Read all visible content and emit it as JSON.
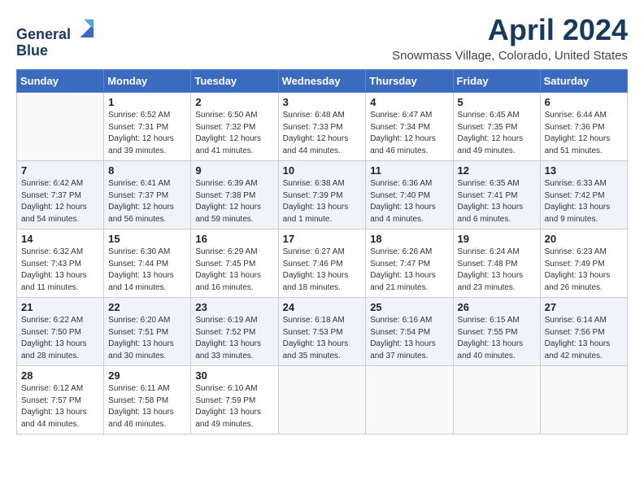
{
  "header": {
    "logo_line1": "General",
    "logo_line2": "Blue",
    "title": "April 2024",
    "subtitle": "Snowmass Village, Colorado, United States"
  },
  "calendar": {
    "days_of_week": [
      "Sunday",
      "Monday",
      "Tuesday",
      "Wednesday",
      "Thursday",
      "Friday",
      "Saturday"
    ],
    "weeks": [
      [
        {
          "day": "",
          "info": ""
        },
        {
          "day": "1",
          "info": "Sunrise: 6:52 AM\nSunset: 7:31 PM\nDaylight: 12 hours\nand 39 minutes."
        },
        {
          "day": "2",
          "info": "Sunrise: 6:50 AM\nSunset: 7:32 PM\nDaylight: 12 hours\nand 41 minutes."
        },
        {
          "day": "3",
          "info": "Sunrise: 6:48 AM\nSunset: 7:33 PM\nDaylight: 12 hours\nand 44 minutes."
        },
        {
          "day": "4",
          "info": "Sunrise: 6:47 AM\nSunset: 7:34 PM\nDaylight: 12 hours\nand 46 minutes."
        },
        {
          "day": "5",
          "info": "Sunrise: 6:45 AM\nSunset: 7:35 PM\nDaylight: 12 hours\nand 49 minutes."
        },
        {
          "day": "6",
          "info": "Sunrise: 6:44 AM\nSunset: 7:36 PM\nDaylight: 12 hours\nand 51 minutes."
        }
      ],
      [
        {
          "day": "7",
          "info": "Sunrise: 6:42 AM\nSunset: 7:37 PM\nDaylight: 12 hours\nand 54 minutes."
        },
        {
          "day": "8",
          "info": "Sunrise: 6:41 AM\nSunset: 7:37 PM\nDaylight: 12 hours\nand 56 minutes."
        },
        {
          "day": "9",
          "info": "Sunrise: 6:39 AM\nSunset: 7:38 PM\nDaylight: 12 hours\nand 59 minutes."
        },
        {
          "day": "10",
          "info": "Sunrise: 6:38 AM\nSunset: 7:39 PM\nDaylight: 13 hours\nand 1 minute."
        },
        {
          "day": "11",
          "info": "Sunrise: 6:36 AM\nSunset: 7:40 PM\nDaylight: 13 hours\nand 4 minutes."
        },
        {
          "day": "12",
          "info": "Sunrise: 6:35 AM\nSunset: 7:41 PM\nDaylight: 13 hours\nand 6 minutes."
        },
        {
          "day": "13",
          "info": "Sunrise: 6:33 AM\nSunset: 7:42 PM\nDaylight: 13 hours\nand 9 minutes."
        }
      ],
      [
        {
          "day": "14",
          "info": "Sunrise: 6:32 AM\nSunset: 7:43 PM\nDaylight: 13 hours\nand 11 minutes."
        },
        {
          "day": "15",
          "info": "Sunrise: 6:30 AM\nSunset: 7:44 PM\nDaylight: 13 hours\nand 14 minutes."
        },
        {
          "day": "16",
          "info": "Sunrise: 6:29 AM\nSunset: 7:45 PM\nDaylight: 13 hours\nand 16 minutes."
        },
        {
          "day": "17",
          "info": "Sunrise: 6:27 AM\nSunset: 7:46 PM\nDaylight: 13 hours\nand 18 minutes."
        },
        {
          "day": "18",
          "info": "Sunrise: 6:26 AM\nSunset: 7:47 PM\nDaylight: 13 hours\nand 21 minutes."
        },
        {
          "day": "19",
          "info": "Sunrise: 6:24 AM\nSunset: 7:48 PM\nDaylight: 13 hours\nand 23 minutes."
        },
        {
          "day": "20",
          "info": "Sunrise: 6:23 AM\nSunset: 7:49 PM\nDaylight: 13 hours\nand 26 minutes."
        }
      ],
      [
        {
          "day": "21",
          "info": "Sunrise: 6:22 AM\nSunset: 7:50 PM\nDaylight: 13 hours\nand 28 minutes."
        },
        {
          "day": "22",
          "info": "Sunrise: 6:20 AM\nSunset: 7:51 PM\nDaylight: 13 hours\nand 30 minutes."
        },
        {
          "day": "23",
          "info": "Sunrise: 6:19 AM\nSunset: 7:52 PM\nDaylight: 13 hours\nand 33 minutes."
        },
        {
          "day": "24",
          "info": "Sunrise: 6:18 AM\nSunset: 7:53 PM\nDaylight: 13 hours\nand 35 minutes."
        },
        {
          "day": "25",
          "info": "Sunrise: 6:16 AM\nSunset: 7:54 PM\nDaylight: 13 hours\nand 37 minutes."
        },
        {
          "day": "26",
          "info": "Sunrise: 6:15 AM\nSunset: 7:55 PM\nDaylight: 13 hours\nand 40 minutes."
        },
        {
          "day": "27",
          "info": "Sunrise: 6:14 AM\nSunset: 7:56 PM\nDaylight: 13 hours\nand 42 minutes."
        }
      ],
      [
        {
          "day": "28",
          "info": "Sunrise: 6:12 AM\nSunset: 7:57 PM\nDaylight: 13 hours\nand 44 minutes."
        },
        {
          "day": "29",
          "info": "Sunrise: 6:11 AM\nSunset: 7:58 PM\nDaylight: 13 hours\nand 46 minutes."
        },
        {
          "day": "30",
          "info": "Sunrise: 6:10 AM\nSunset: 7:59 PM\nDaylight: 13 hours\nand 49 minutes."
        },
        {
          "day": "",
          "info": ""
        },
        {
          "day": "",
          "info": ""
        },
        {
          "day": "",
          "info": ""
        },
        {
          "day": "",
          "info": ""
        }
      ]
    ]
  }
}
